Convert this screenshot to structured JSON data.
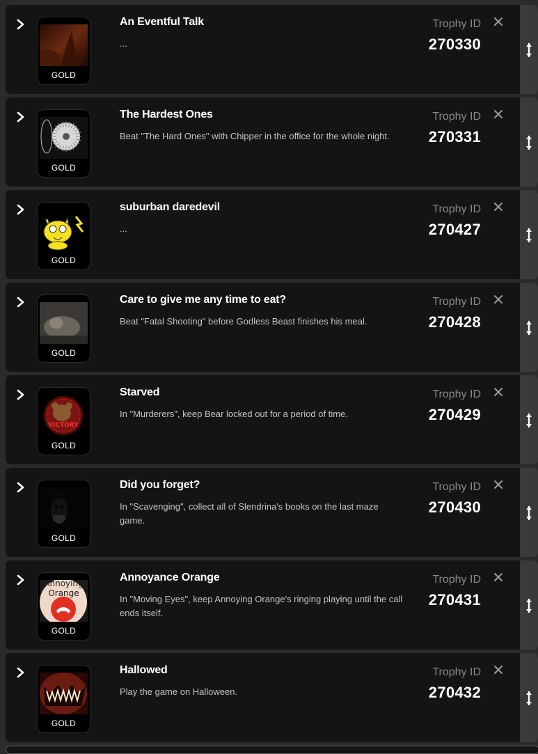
{
  "trophy_id_label": "Trophy ID",
  "trophies": [
    {
      "title": "An Eventful Talk",
      "description": "...",
      "tier": "GOLD",
      "id": "270330",
      "icon": "dark-red-scene-thumbnail"
    },
    {
      "title": "The Hardest Ones",
      "description": "Beat \"The Hard Ones\" with Chipper in the office for the whole night.",
      "tier": "GOLD",
      "id": "270331",
      "icon": "fan-saw-thumbnail"
    },
    {
      "title": "suburban daredevil",
      "description": "...",
      "tier": "GOLD",
      "id": "270427",
      "icon": "yellow-cat-thumbnail"
    },
    {
      "title": "Care to give me any time to eat?",
      "description": "Beat \"Fatal Shooting\" before Godless Beast finishes his meal.",
      "tier": "GOLD",
      "id": "270428",
      "icon": "grey-creature-thumbnail"
    },
    {
      "title": "Starved",
      "description": "In \"Murderers\", keep Bear locked out for a period of time.",
      "tier": "GOLD",
      "id": "270429",
      "icon": "victory-bear-thumbnail"
    },
    {
      "title": "Did you forget?",
      "description": "In \"Scavenging\", collect all of Slendrina's books on the last maze game.",
      "tier": "GOLD",
      "id": "270430",
      "icon": "ghost-face-thumbnail"
    },
    {
      "title": "Annoyance Orange",
      "description": "In \"Moving Eyes\", keep Annoying Orange's ringing playing until the call ends itself.",
      "tier": "GOLD",
      "id": "270431",
      "icon": "orange-call-thumbnail",
      "icon_caption": "Annoying Orange"
    },
    {
      "title": "Hallowed",
      "description": "Play the game on Halloween.",
      "tier": "GOLD",
      "id": "270432",
      "icon": "pumpkin-thumbnail"
    }
  ],
  "colors": {
    "card_bg": "#141414",
    "page_bg": "#2b2b2b",
    "handle_bg": "#3a3a3a",
    "title": "#ffffff",
    "description": "#c4c4c4",
    "label": "#8a8a8a"
  }
}
